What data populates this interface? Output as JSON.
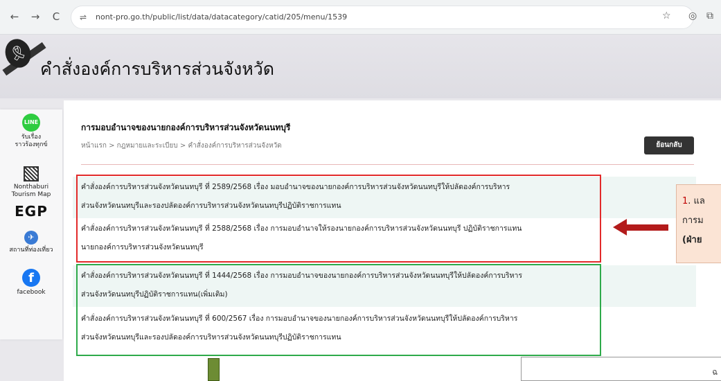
{
  "browser": {
    "url": "nont-pro.go.th/public/list/data/datacategory/catid/205/menu/1539",
    "back_glyph": "←",
    "forward_glyph": "→",
    "reload_glyph": "C",
    "site_settings_glyph": "⇌",
    "star_glyph": "☆",
    "camera_glyph": "◎",
    "extension_glyph": "⧉"
  },
  "banner": {
    "ribbon_glyph": "🎗",
    "title": "คำสั่งองค์การบริหารส่วนจังหวัด"
  },
  "sidebar": {
    "items": [
      {
        "icon_text": "LINE",
        "label1": "รับเรื่อง",
        "label2": "ราวร้องทุกข์"
      },
      {
        "label1": "Nonthaburi",
        "label2": "Tourism Map"
      },
      {
        "icon_text": "EGP"
      },
      {
        "icon_text": "✈",
        "label1": "สถานที่ท่องเที่ยว"
      },
      {
        "icon_text": "f",
        "label1": "facebook"
      }
    ]
  },
  "section": {
    "title": "การมอบอำนาจของนายกองค์การบริหารส่วนจังหวัดนนทบุรี",
    "breadcrumb": "หน้าแรก > กฎหมายและระเบียบ > คำสั่งองค์การบริหารส่วนจังหวัด",
    "back_button": "ย้อนกลับ"
  },
  "rows": [
    {
      "line1": "คำสั่งองค์การบริหารส่วนจังหวัดนนทบุรี ที่ 2589/2568 เรื่อง มอบอำนาจของนายกองค์การบริหารส่วนจังหวัดนนทบุรีให้ปลัดองค์การบริหาร",
      "line2": "ส่วนจังหวัดนนทบุรีและรองปลัดองค์การบริหารส่วนจังหวัดนนทบุรีปฏิบัติราชการแทน"
    },
    {
      "line1": "คำสั่งองค์การบริหารส่วนจังหวัดนนทบุรี ที่ 2588/2568 เรื่อง การมอบอำนาจให้รองนายกองค์การบริหารส่วนจังหวัดนนทบุรี ปฏิบัติราชการแทน",
      "line2": "นายกองค์การบริหารส่วนจังหวัดนนทบุรี"
    },
    {
      "line1": "คำสั่งองค์การบริหารส่วนจังหวัดนนทบุรี ที่ 1444/2568 เรื่อง การมอบอำนาจของนายกองค์การบริหารส่วนจังหวัดนนทบุรีให้ปลัดองค์การบริหาร",
      "line2": "ส่วนจังหวัดนนทบุรีปฏิบัติราชการแทน(เพิ่มเติม)"
    },
    {
      "line1": "คำสั่งองค์การบริหารส่วนจังหวัดนนทบุรี ที่ 600/2567 เรื่อง การมอบอำนาจของนายกองค์การบริหารส่วนจังหวัดนนทบุรีให้ปลัดองค์การบริหาร",
      "line2": "ส่วนจังหวัดนนทบุรีและรองปลัดองค์การบริหารส่วนจังหวัดนนทบุรีปฏิบัติราชการแทน"
    }
  ],
  "callout": {
    "number": "1",
    "line1": ". แล",
    "line2": "การม",
    "line3": "(ฝ่าย"
  },
  "overlay": {
    "text": "ฉ"
  },
  "colors": {
    "red_highlight": "#e22a2a",
    "green_highlight": "#2eaa4a",
    "arrow": "#b31b1b",
    "callout_bg": "#fbe4d5"
  }
}
